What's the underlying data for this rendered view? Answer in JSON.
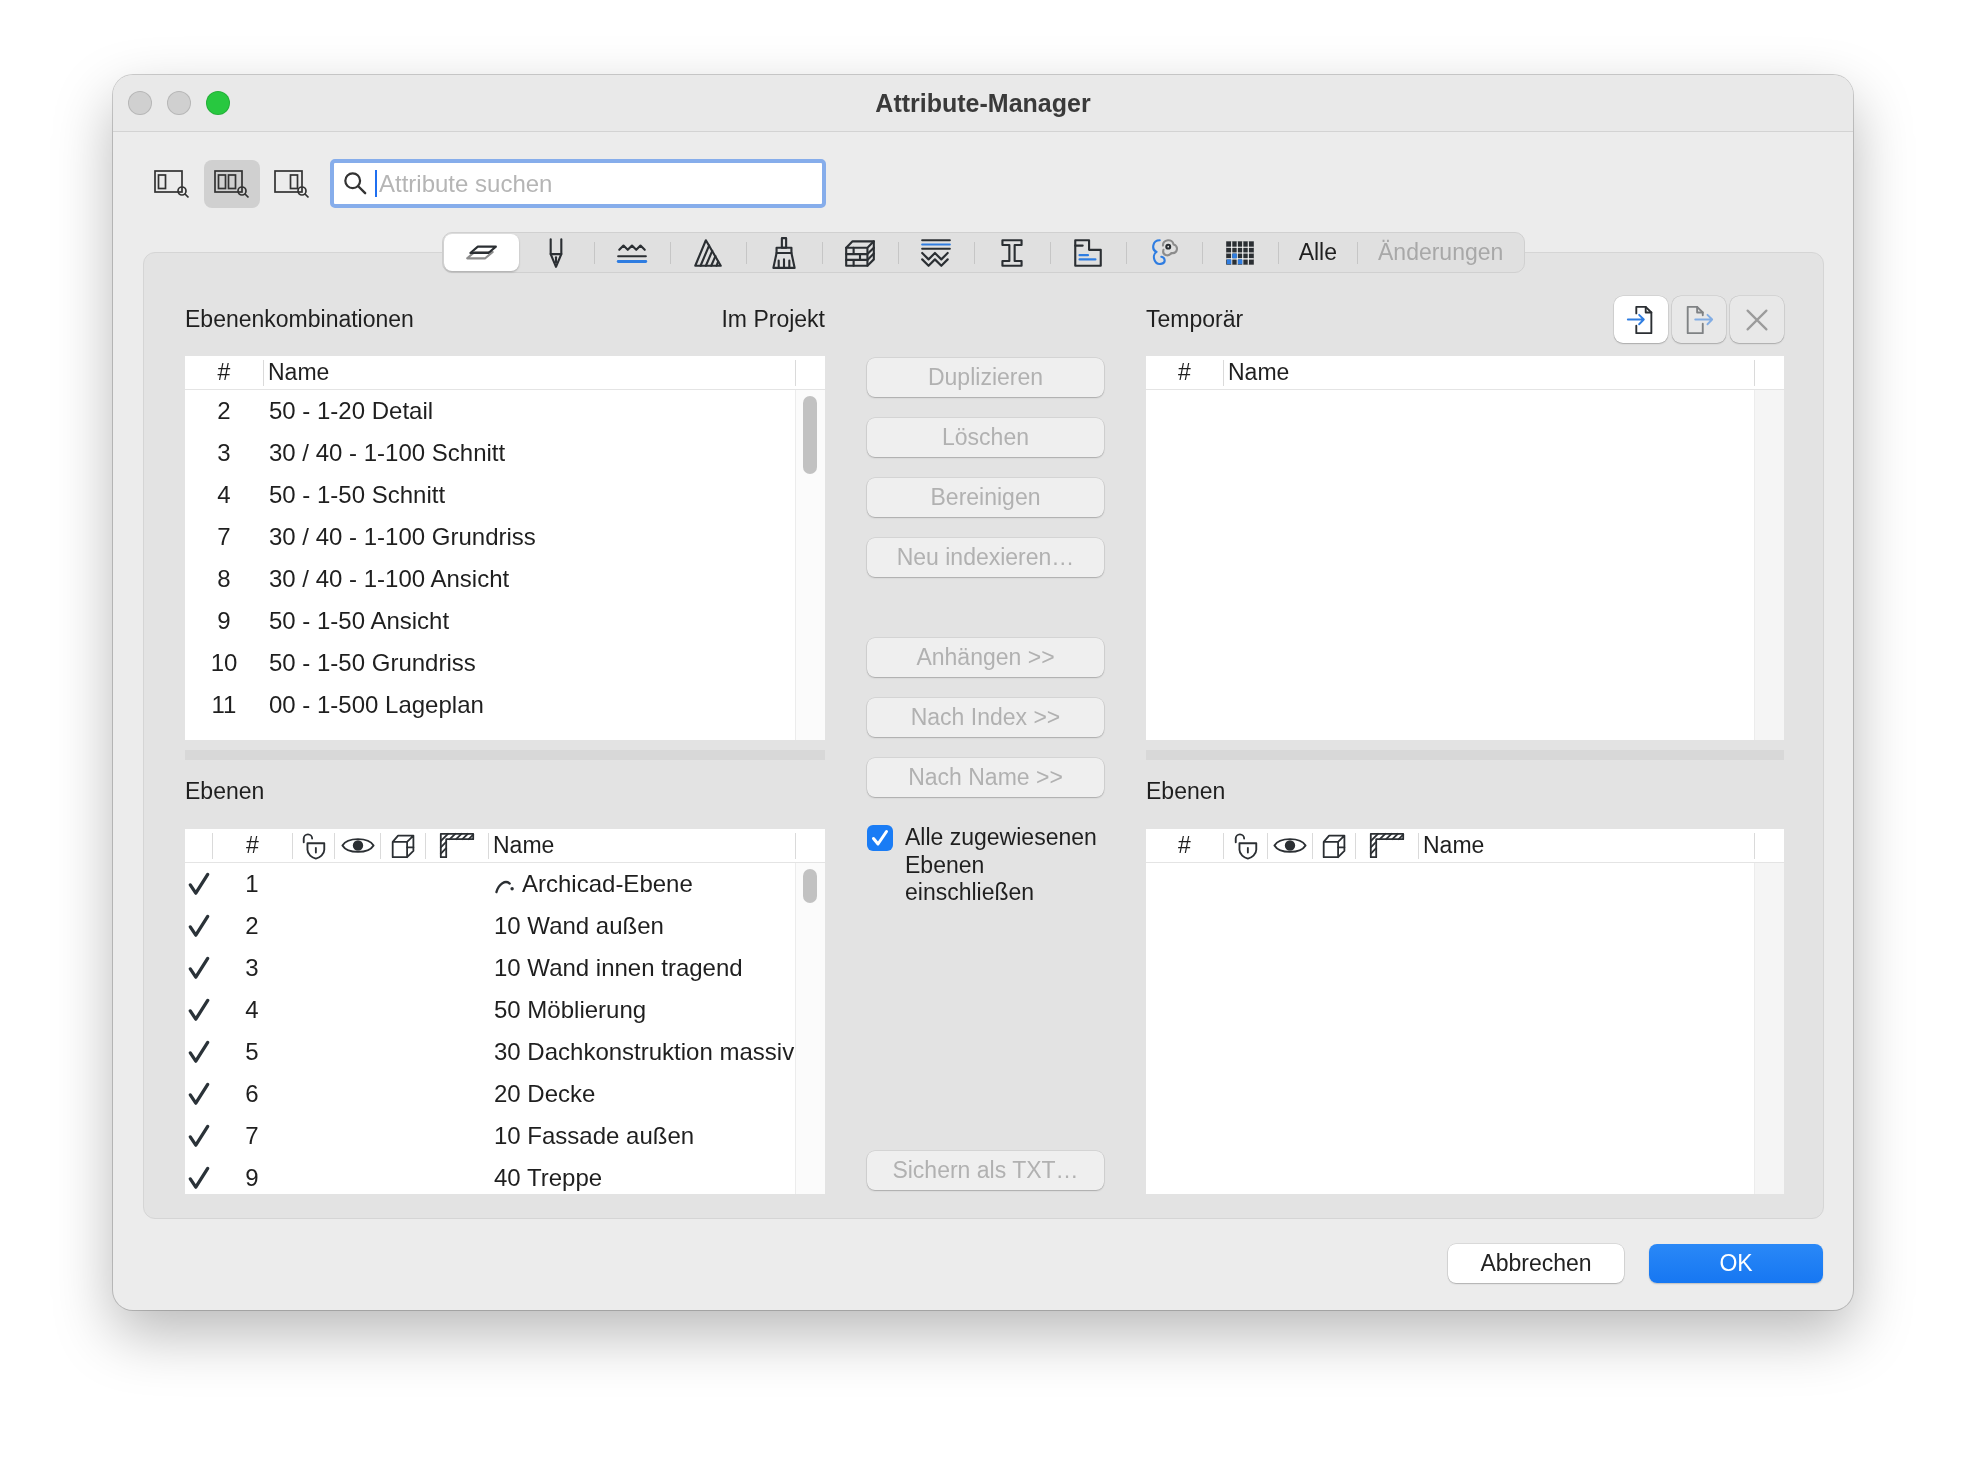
{
  "window": {
    "title": "Attribute-Manager",
    "controls": [
      {
        "disabled": true
      },
      {
        "disabled": true
      },
      {
        "disabled": false
      }
    ]
  },
  "toolbar": {
    "view_modes": [
      {
        "selected": false
      },
      {
        "selected": true
      },
      {
        "selected": false
      }
    ],
    "search": {
      "placeholder": "Attribute suchen"
    }
  },
  "attribute_tabs": [
    {
      "kind": "icon",
      "selected": true,
      "disabled": false
    },
    {
      "kind": "icon",
      "selected": false,
      "disabled": false
    },
    {
      "kind": "icon",
      "selected": false,
      "disabled": false
    },
    {
      "kind": "icon",
      "selected": false,
      "disabled": false
    },
    {
      "kind": "icon",
      "selected": false,
      "disabled": false
    },
    {
      "kind": "icon",
      "selected": false,
      "disabled": false
    },
    {
      "kind": "icon",
      "selected": false,
      "disabled": false
    },
    {
      "kind": "icon",
      "selected": false,
      "disabled": false
    },
    {
      "kind": "icon",
      "selected": false,
      "disabled": false
    },
    {
      "kind": "icon",
      "selected": false,
      "disabled": false
    },
    {
      "kind": "icon",
      "selected": false,
      "disabled": false
    },
    {
      "kind": "text",
      "label": "Alle",
      "selected": false,
      "disabled": false
    },
    {
      "kind": "text",
      "label": "Änderungen",
      "selected": false,
      "disabled": true
    }
  ],
  "project": {
    "title": "Ebenenkombinationen",
    "caption": "Im Projekt",
    "combinations": {
      "columns": [
        "#",
        "Name"
      ],
      "rows": [
        {
          "number": "2",
          "name": "50 - 1-20 Detail"
        },
        {
          "number": "3",
          "name": "30 / 40 - 1-100 Schnitt"
        },
        {
          "number": "4",
          "name": "50 - 1-50 Schnitt"
        },
        {
          "number": "7",
          "name": "30 / 40 - 1-100 Grundriss"
        },
        {
          "number": "8",
          "name": "30 / 40 - 1-100 Ansicht"
        },
        {
          "number": "9",
          "name": "50 - 1-50 Ansicht"
        },
        {
          "number": "10",
          "name": "50 - 1-50 Grundriss"
        },
        {
          "number": "11",
          "name": "00 - 1-500 Lageplan"
        }
      ]
    },
    "layers": {
      "title": "Ebenen",
      "columns": [
        "#",
        "Name"
      ],
      "rows": [
        {
          "checked": true,
          "number": "1",
          "name": "Archicad-Ebene",
          "kind": "builtin"
        },
        {
          "checked": true,
          "number": "2",
          "name": "10 Wand außen",
          "kind": "user"
        },
        {
          "checked": true,
          "number": "3",
          "name": "10 Wand innen tragend",
          "kind": "user"
        },
        {
          "checked": true,
          "number": "4",
          "name": "50 Möblierung",
          "kind": "user"
        },
        {
          "checked": true,
          "number": "5",
          "name": "30 Dachkonstruktion massiv",
          "kind": "user"
        },
        {
          "checked": true,
          "number": "6",
          "name": "20 Decke",
          "kind": "user"
        },
        {
          "checked": true,
          "number": "7",
          "name": "10 Fassade außen",
          "kind": "user"
        },
        {
          "checked": true,
          "number": "9",
          "name": "40 Treppe",
          "kind": "user"
        }
      ]
    }
  },
  "actions": {
    "edit_buttons": [
      {
        "label": "Duplizieren",
        "disabled": true
      },
      {
        "label": "Löschen",
        "disabled": true
      },
      {
        "label": "Bereinigen",
        "disabled": true
      },
      {
        "label": "Neu indexieren…",
        "disabled": true
      }
    ],
    "transfer_buttons": [
      {
        "label": "Anhängen >>",
        "disabled": true
      },
      {
        "label": "Nach Index >>",
        "disabled": true
      },
      {
        "label": "Nach Name >>",
        "disabled": true
      }
    ],
    "include_layers": {
      "label": "Alle zugewiesenen Ebenen einschließen",
      "checked": true
    },
    "export_button": {
      "label": "Sichern als TXT…",
      "disabled": true
    }
  },
  "temporary": {
    "title": "Temporär",
    "file_buttons": [
      {
        "disabled": false
      },
      {
        "disabled": true
      },
      {
        "disabled": true
      }
    ],
    "combinations": {
      "columns": [
        "#",
        "Name"
      ]
    },
    "layers": {
      "title": "Ebenen",
      "columns": [
        "#",
        "Name"
      ]
    }
  },
  "footer": {
    "buttons": [
      {
        "label": "Abbrechen",
        "kind": "cancel"
      },
      {
        "label": "OK",
        "kind": "default"
      }
    ]
  }
}
